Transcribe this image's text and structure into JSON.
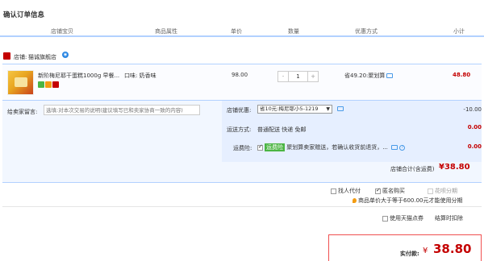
{
  "page": {
    "title": "确认订单信息"
  },
  "columns": [
    "店铺宝贝",
    "商品属性",
    "单价",
    "数量",
    "优惠方式",
    "小计"
  ],
  "shop": {
    "label": "店铺:",
    "name": "猫诚旗舰店"
  },
  "item": {
    "title": "新阶梅尼耶干蛋糕1000g 早餐...",
    "property": "口味: 奶香味",
    "unit_price": "98.00",
    "quantity": "1",
    "minus": "-",
    "plus": "+",
    "promo": "省49.20:聚划算",
    "subtotal": "48.80"
  },
  "message": {
    "label": "给卖家留言:",
    "placeholder": "选填:对本次交易的说明(建议填写已和卖家协商一致的内容)"
  },
  "store_discount": {
    "label": "店铺优惠:",
    "selected": "省10元:梅尼耶小5-1219",
    "amount": "-10.00"
  },
  "shipping": {
    "label": "运送方式:",
    "value": "普通配送 快递 免邮",
    "amount": "0.00"
  },
  "insurance": {
    "label": "运费险:",
    "tag": "运费险",
    "desc": "聚划算卖家赠送，若确认收货前退货，...",
    "amount": "0.00"
  },
  "shop_total": {
    "label": "店铺合计(含运费)",
    "amount": "¥38.80"
  },
  "options": {
    "proxy_pay": "找人代付",
    "anonymous": "匿名购买",
    "installment": "花呗分期",
    "installment_tip": "商品单价大于等于600.00元才能使用分期",
    "tmall_points": "使用天猫点券",
    "checkout_deduct": "结算时扣除"
  },
  "payment": {
    "label": "实付款:",
    "currency": "¥",
    "amount": "38.80"
  },
  "colors": {
    "accent": "#c40000",
    "header_border": "#b2d1ff",
    "panel_bg": "#e6efff"
  }
}
